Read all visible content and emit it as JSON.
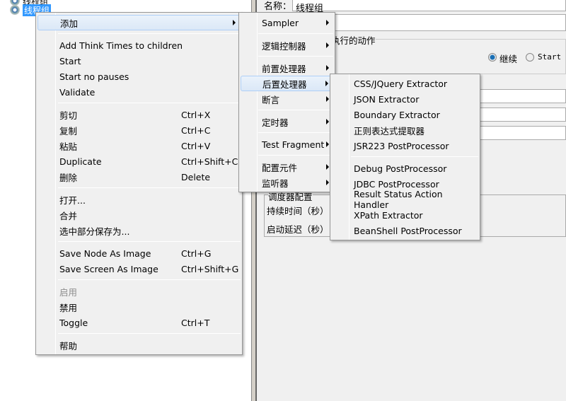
{
  "tree": {
    "nodes": [
      {
        "label": "线程组"
      },
      {
        "label": "线程组",
        "selected": true
      }
    ]
  },
  "panel": {
    "name_label": "名称：",
    "name_value": "线程组",
    "action_label": "线程结束后要执行的动作",
    "radio_continue": "继续",
    "radio_start": "Start N",
    "scheduler_label": "调度器配置",
    "duration_label": "持续时间（秒）",
    "delay_label": "启动延迟（秒）"
  },
  "context_menu": {
    "items": [
      {
        "label": "添加",
        "submenu": true,
        "highlighted": true
      },
      {
        "label": "Add Think Times to children"
      },
      {
        "label": "Start"
      },
      {
        "label": "Start no pauses"
      },
      {
        "label": "Validate"
      },
      {
        "label": "剪切",
        "shortcut": "Ctrl+X"
      },
      {
        "label": "复制",
        "shortcut": "Ctrl+C"
      },
      {
        "label": "粘贴",
        "shortcut": "Ctrl+V"
      },
      {
        "label": "Duplicate",
        "shortcut": "Ctrl+Shift+C"
      },
      {
        "label": "删除",
        "shortcut": "Delete"
      },
      {
        "label": "打开..."
      },
      {
        "label": "合并"
      },
      {
        "label": "选中部分保存为..."
      },
      {
        "label": "Save Node As Image",
        "shortcut": "Ctrl+G"
      },
      {
        "label": "Save Screen As Image",
        "shortcut": "Ctrl+Shift+G"
      },
      {
        "label": "启用",
        "disabled": true
      },
      {
        "label": "禁用"
      },
      {
        "label": "Toggle",
        "shortcut": "Ctrl+T"
      },
      {
        "label": "帮助"
      }
    ]
  },
  "add_submenu": {
    "items": [
      {
        "label": "Sampler"
      },
      {
        "label": "逻辑控制器"
      },
      {
        "label": "前置处理器"
      },
      {
        "label": "后置处理器",
        "highlighted": true
      },
      {
        "label": "断言"
      },
      {
        "label": "定时器"
      },
      {
        "label": "Test Fragment"
      },
      {
        "label": "配置元件"
      },
      {
        "label": "监听器"
      }
    ]
  },
  "postprocessor_submenu": {
    "items": [
      {
        "label": "CSS/JQuery Extractor"
      },
      {
        "label": "JSON Extractor"
      },
      {
        "label": "Boundary Extractor"
      },
      {
        "label": "正则表达式提取器"
      },
      {
        "label": "JSR223 PostProcessor"
      },
      {
        "label": "Debug PostProcessor"
      },
      {
        "label": "JDBC PostProcessor"
      },
      {
        "label": "Result Status Action Handler"
      },
      {
        "label": "XPath Extractor"
      },
      {
        "label": "BeanShell PostProcessor"
      }
    ]
  }
}
